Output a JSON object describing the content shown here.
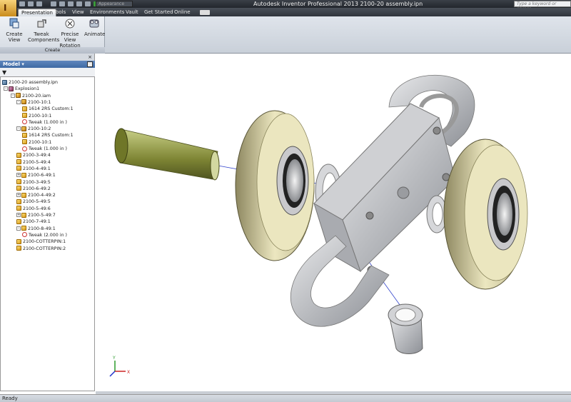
{
  "window": {
    "title": "Autodesk Inventor Professional 2013     2100-20 assembly.ipn"
  },
  "quick_access": {
    "appearance": "Appearance"
  },
  "search": {
    "placeholder": "Type a keyword or phrase"
  },
  "tabs": [
    {
      "label": "Presentation",
      "active": true
    },
    {
      "label": "Tools"
    },
    {
      "label": "View"
    },
    {
      "label": "Environments"
    },
    {
      "label": "Vault"
    },
    {
      "label": "Get Started"
    },
    {
      "label": "Online"
    }
  ],
  "ribbon": {
    "buttons": [
      {
        "label": "Create View",
        "icon": "create-view-icon"
      },
      {
        "label": "Tweak\nComponents",
        "icon": "tweak-components-icon"
      },
      {
        "label": "Precise View\nRotation",
        "icon": "precise-rotation-icon"
      },
      {
        "label": "Animate",
        "icon": "animate-icon"
      }
    ],
    "panel_label": "Create"
  },
  "browser": {
    "title": "Model",
    "tree": [
      {
        "label": "2100-20 assembly.ipn",
        "icon": "ipn"
      },
      {
        "label": "Explosion1",
        "icon": "explosion"
      },
      {
        "label": "2100-20.iam",
        "icon": "assembly"
      },
      {
        "label": "2100-10:1",
        "icon": "assembly"
      },
      {
        "label": "1614 2RS Custom:1",
        "icon": "part"
      },
      {
        "label": "2100-10:1",
        "icon": "part"
      },
      {
        "label": "Tweak (1.000 in )",
        "icon": "tweak"
      },
      {
        "label": "2100-10:2",
        "icon": "assembly"
      },
      {
        "label": "1614 2RS Custom:1",
        "icon": "part"
      },
      {
        "label": "2100-10:1",
        "icon": "part"
      },
      {
        "label": "Tweak (1.000 in )",
        "icon": "tweak"
      },
      {
        "label": "2100-3-49:4",
        "icon": "part"
      },
      {
        "label": "2100-5-49:4",
        "icon": "part"
      },
      {
        "label": "2100-4-49:1",
        "icon": "part"
      },
      {
        "label": "2100-6-49:1",
        "icon": "part"
      },
      {
        "label": "2100-3-49:5",
        "icon": "part"
      },
      {
        "label": "2100-6-49:2",
        "icon": "part"
      },
      {
        "label": "2100-4-49:2",
        "icon": "part"
      },
      {
        "label": "2100-5-49:5",
        "icon": "part"
      },
      {
        "label": "2100-5-49:6",
        "icon": "part"
      },
      {
        "label": "2100-5-49:7",
        "icon": "part"
      },
      {
        "label": "2100-7-49:1",
        "icon": "part"
      },
      {
        "label": "2100-8-49:1",
        "icon": "part"
      },
      {
        "label": "Tweak (2.000 in )",
        "icon": "tweak"
      },
      {
        "label": "2100-COTTERPIN:1",
        "icon": "part"
      },
      {
        "label": "2100-COTTERPIN:2",
        "icon": "part"
      }
    ]
  },
  "status": {
    "text": "Ready"
  },
  "colors": {
    "accent": "#3f6aa4",
    "tire": "#e2ddb0",
    "pin": "#8c9640",
    "metal": "#b5b8bd"
  }
}
